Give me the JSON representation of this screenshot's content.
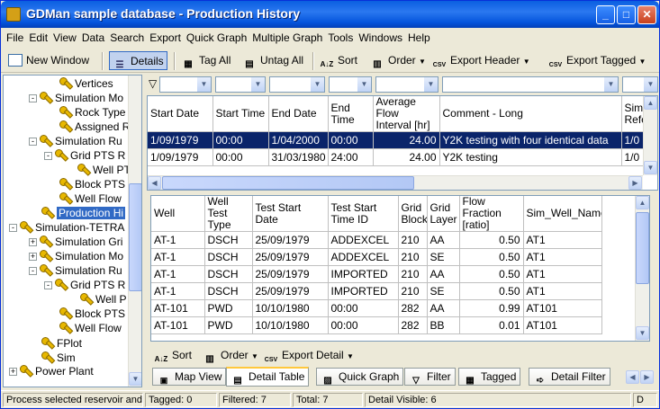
{
  "window": {
    "title": "GDMan sample database - Production History",
    "minimize_label": "_",
    "maximize_label": "□",
    "close_label": "✕"
  },
  "menu": [
    "File",
    "Edit",
    "View",
    "Data",
    "Search",
    "Export",
    "Quick Graph",
    "Multiple Graph",
    "Tools",
    "Windows",
    "Help"
  ],
  "toolbar": {
    "new_window": "New Window",
    "details": "Details",
    "tag_all": "Tag All",
    "untag_all": "Untag All",
    "sort": "Sort",
    "order": "Order",
    "export_header": "Export Header",
    "export_tagged": "Export Tagged"
  },
  "tree": [
    {
      "label": "Vertices",
      "expander": ""
    },
    {
      "label": "Simulation Mo",
      "expander": "-"
    },
    {
      "label": "Rock Type",
      "expander": ""
    },
    {
      "label": "Assigned R",
      "expander": ""
    },
    {
      "label": "Simulation Ru",
      "expander": "-"
    },
    {
      "label": "Grid PTS R",
      "expander": "-"
    },
    {
      "label": "Well PT",
      "expander": ""
    },
    {
      "label": "Block PTS",
      "expander": ""
    },
    {
      "label": "Well Flow",
      "expander": ""
    },
    {
      "label": "Production Hi",
      "expander": ""
    },
    {
      "label": "Simulation-TETRA",
      "expander": "-"
    },
    {
      "label": "Simulation Gri",
      "expander": "+"
    },
    {
      "label": "Simulation Mo",
      "expander": "+"
    },
    {
      "label": "Simulation Ru",
      "expander": "-"
    },
    {
      "label": "Grid PTS R",
      "expander": "-"
    },
    {
      "label": "Well P",
      "expander": ""
    },
    {
      "label": "Block PTS",
      "expander": ""
    },
    {
      "label": "Well Flow",
      "expander": ""
    },
    {
      "label": "FPlot",
      "expander": ""
    },
    {
      "label": "Sim",
      "expander": ""
    },
    {
      "label": "Power Plant",
      "expander": "+"
    }
  ],
  "header_grid": {
    "columns": [
      "Start Date",
      "Start Time",
      "End Date",
      "End Time",
      "Average Flow Interval [hr]",
      "Comment - Long",
      "Simu Refe"
    ],
    "rows": [
      [
        "1/09/1979",
        "00:00",
        "1/04/2000",
        "00:00",
        "24.00",
        "Y2K testing with four identical data",
        "1/0"
      ],
      [
        "1/09/1979",
        "00:00",
        "31/03/1980",
        "24:00",
        "24.00",
        "Y2K testing",
        "1/0"
      ]
    ]
  },
  "detail_grid": {
    "columns": [
      "Well",
      "Well Test Type",
      "Test Start Date",
      "Test Start Time ID",
      "Grid Block",
      "Grid Layer",
      "Flow Fraction [ratio]",
      "Sim_Well_Name"
    ],
    "rows": [
      [
        "AT-1",
        "DSCH",
        "25/09/1979",
        "ADDEXCEL",
        "210",
        "AA",
        "0.50",
        "AT1"
      ],
      [
        "AT-1",
        "DSCH",
        "25/09/1979",
        "ADDEXCEL",
        "210",
        "SE",
        "0.50",
        "AT1"
      ],
      [
        "AT-1",
        "DSCH",
        "25/09/1979",
        "IMPORTED",
        "210",
        "AA",
        "0.50",
        "AT1"
      ],
      [
        "AT-1",
        "DSCH",
        "25/09/1979",
        "IMPORTED",
        "210",
        "SE",
        "0.50",
        "AT1"
      ],
      [
        "AT-101",
        "PWD",
        "10/10/1980",
        "00:00",
        "282",
        "AA",
        "0.99",
        "AT101"
      ],
      [
        "AT-101",
        "PWD",
        "10/10/1980",
        "00:00",
        "282",
        "BB",
        "0.01",
        "AT101"
      ]
    ]
  },
  "detail_toolbar": {
    "sort": "Sort",
    "order": "Order",
    "export_detail": "Export Detail"
  },
  "tabs": [
    "Map View",
    "Detail Table",
    "Quick Graph",
    "Filter",
    "Tagged",
    "Detail Filter"
  ],
  "status": {
    "hint": "Process selected reservoir and p",
    "tagged": "Tagged: 0",
    "filtered": "Filtered: 7",
    "total": "Total: 7",
    "detail_visible": "Detail Visible: 6",
    "last": "D"
  },
  "colors": {
    "title_bar": "#0a5fe0",
    "selection": "#0a246a",
    "tree_selection": "#316ac5"
  }
}
